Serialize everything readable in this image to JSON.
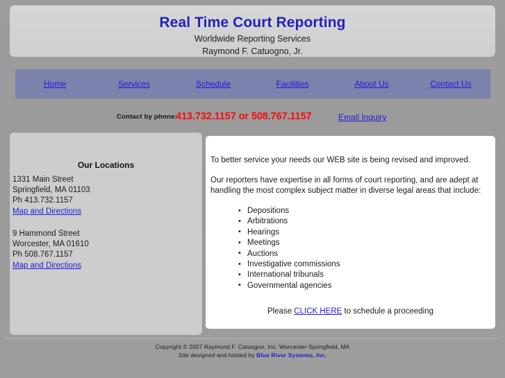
{
  "header": {
    "title": "Real Time Court Reporting",
    "subtitle1": "Worldwide Reporting Services",
    "subtitle2": "Raymond F. Catuogno, Jr."
  },
  "nav": {
    "items": [
      {
        "label": "Home"
      },
      {
        "label": "Services"
      },
      {
        "label": "Schedule"
      },
      {
        "label": "Facilities"
      },
      {
        "label": "About Us"
      },
      {
        "label": "Contact Us"
      }
    ]
  },
  "contact": {
    "label": "Contact by phone:",
    "phones": "413.732.1157 or 508.767.1157",
    "email_link": "Email Inquiry"
  },
  "locations": {
    "heading": "Our Locations",
    "entries": [
      {
        "street": "1331 Main Street",
        "city": "Springfield, MA 01103",
        "phone": "Ph 413.732.1157",
        "map_link": "Map and Directions"
      },
      {
        "street": "9 Hammond Street",
        "city": "Worcester, MA 01610",
        "phone": "Ph 508.767.1157",
        "map_link": "Map and Directions"
      }
    ]
  },
  "main": {
    "paragraph1": "To better service your needs our WEB site is being revised and improved.",
    "paragraph2": "Our reporters have expertise in all forms of court reporting, and are adept at handling the most complex subject matter in diverse legal areas that include:",
    "services": [
      "Depositions",
      "Arbitrations",
      "Hearings",
      "Meetings",
      "Auctions",
      "Investigative commissions",
      "International tribunals",
      "Governmental agencies"
    ],
    "cta_prefix": "Please ",
    "cta_link": "CLICK HERE",
    "cta_suffix": " to schedule a proceeding"
  },
  "footer": {
    "copyright": "Copyright © 2007 Raymond F. Catuogno, Inc. Worcester-Springfield, MA",
    "credit_prefix": "Site designed and hosted by ",
    "credit_brand": "Blue River Systems, Inc."
  },
  "colors": {
    "title_blue": "#2222bb",
    "link_blue": "#1c1cdd",
    "phone_red": "#fa0a0a",
    "nav_bg": "#7b82ab",
    "page_bg": "#9a9a9a",
    "panel_gray": "#cdcdcd",
    "content_white": "#ffffff"
  }
}
